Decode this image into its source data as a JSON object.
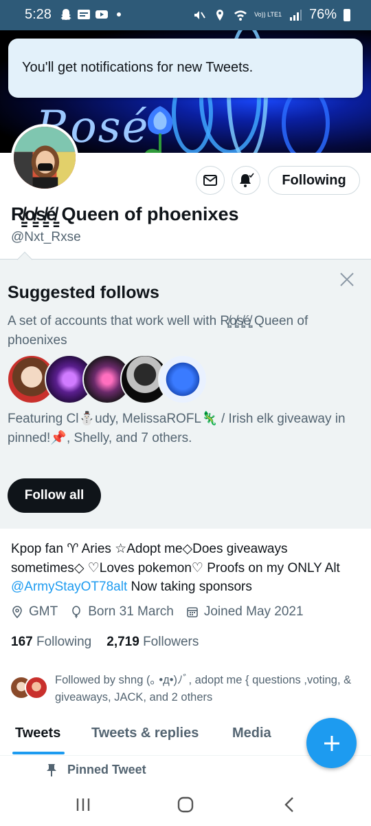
{
  "status_bar": {
    "time": "5:28",
    "battery": "76%",
    "network_label": "Vo)) LTE1",
    "icons": [
      "snapchat-icon",
      "news-icon",
      "youtube-icon",
      "mute-icon",
      "location-icon",
      "wifi-icon",
      "signal-icon",
      "battery-icon"
    ]
  },
  "banner": {
    "text": "Rosé"
  },
  "toast": {
    "message": "You'll get notifications for new Tweets."
  },
  "profile": {
    "display_name": "R̸̤̳o̸̤̳s̸̤̳é̸̤̳ Queen of phoenixes",
    "handle": "@Nxt_Rxse",
    "following_button": "Following"
  },
  "suggested": {
    "title": "Suggested follows",
    "description": "A set of accounts that work well with R̸̤̳o̸̤̳s̸̤̳é̸̤̳ Queen of phoenixes",
    "featuring": "Featuring Cl⛄udy, MelissaROFL🦎 / Irish elk giveaway in pinned!📌, Shelly, and 7 others.",
    "follow_all": "Follow all"
  },
  "bio": {
    "text_1": "Kpop fan ♈ Aries ☆Adopt me◇Does giveaways sometimes◇ ♡Loves pokemon♡ Proofs on my ONLY Alt ",
    "link": "@ArmyStayOT78alt",
    "text_2": " Now taking sponsors"
  },
  "meta": {
    "location": "GMT",
    "birthday": "Born 31 March",
    "joined": "Joined May 2021"
  },
  "counts": {
    "following_num": "167",
    "following_label": "Following",
    "followers_num": "2,719",
    "followers_label": "Followers"
  },
  "followed_by": {
    "text": "Followed by shng (｡ •д•)ﾉﾞ, adopt me { questions ,voting, & giveaways, JACK, and 2 others"
  },
  "tabs": {
    "tweets": "Tweets",
    "replies": "Tweets & replies",
    "media": "Media"
  },
  "pinned": {
    "label": "Pinned Tweet"
  },
  "colors": {
    "accent": "#1d9bf0",
    "text": "#0f1419",
    "muted": "#536471",
    "panel": "#eff3f4"
  }
}
